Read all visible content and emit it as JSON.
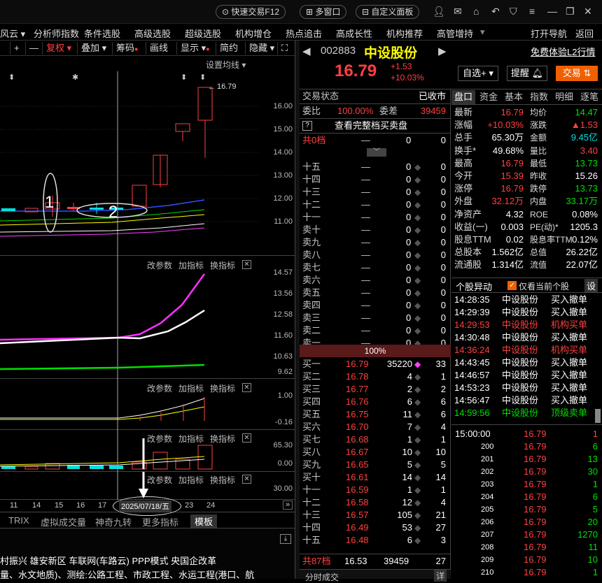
{
  "topbar": {
    "quick_trade": "快速交易F12",
    "multi_window": "多窗口",
    "custom_panel": "自定义面板"
  },
  "menu": {
    "items": [
      "风云",
      "分析师指数",
      "条件选股",
      "高级选股",
      "超级选股",
      "机构增仓",
      "热点追击",
      "高成长性",
      "机构推荐",
      "高管增持"
    ],
    "open_nav": "打开导航",
    "back": "返回"
  },
  "chart_toolbar": {
    "restore": "复权",
    "overlay": "叠加",
    "chips": "筹码",
    "draw": "画线",
    "display": "显示",
    "simple": "简约",
    "hide": "隐藏",
    "set_ma": "设置均线"
  },
  "kline": {
    "axis": [
      "16.00",
      "15.00",
      "14.00",
      "13.00",
      "12.00",
      "11.00"
    ],
    "max_label": "16.79",
    "anno1": "1",
    "anno2": "2"
  },
  "panel_actions": {
    "change_param": "改参数",
    "add_index": "加指标",
    "switch_index": "换指标"
  },
  "ind1": {
    "axis": [
      "14.57",
      "13.56",
      "12.58",
      "11.60",
      "10.63",
      "9.62"
    ]
  },
  "ind2": {
    "axis": [
      "1.00",
      "-0.16"
    ]
  },
  "ind3": {
    "axis": [
      "65.30",
      "0.00"
    ]
  },
  "ind4": {
    "axis": [
      "30.00"
    ]
  },
  "xaxis": {
    "labels": [
      "11",
      "14",
      "15",
      "16",
      "17",
      "23",
      "24"
    ],
    "selected_date": "2025/07/18/五"
  },
  "tabs": {
    "items": [
      "TRIX",
      "虚拟成交量",
      "神奇九转",
      "更多指标",
      "模板"
    ]
  },
  "news": {
    "line1": "村振兴  雄安新区  车联网(车路云)  PPP模式  央国企改革",
    "line2": "量、水文地质)、测绘:公路工程、市政工程、水运工程(港口、航"
  },
  "stock": {
    "code": "002883",
    "name": "中设股份",
    "price": "16.79",
    "change": "+1.53",
    "pct": "+10.03%",
    "l2": "免费体验L2行情",
    "watchlist": "自选+",
    "alert": "提醒",
    "trade": "交易"
  },
  "ob": {
    "status_label": "交易状态",
    "status": "已收市",
    "ratio_label": "委比",
    "ratio": "100.00%",
    "diff_label": "委差",
    "diff": "39459",
    "full": "查看完整档买卖盘",
    "total0": "共0档",
    "total0_v1": "0",
    "total0_v2": "0",
    "pct": "100%",
    "upper": [
      {
        "l": "十五",
        "p": "—",
        "v": "0",
        "c": "0"
      },
      {
        "l": "十四",
        "p": "—",
        "v": "0",
        "c": "0"
      },
      {
        "l": "十三",
        "p": "—",
        "v": "0",
        "c": "0"
      },
      {
        "l": "十二",
        "p": "—",
        "v": "0",
        "c": "0"
      },
      {
        "l": "十一",
        "p": "—",
        "v": "0",
        "c": "0"
      },
      {
        "l": "卖十",
        "p": "—",
        "v": "0",
        "c": "0"
      },
      {
        "l": "卖九",
        "p": "—",
        "v": "0",
        "c": "0"
      },
      {
        "l": "卖八",
        "p": "—",
        "v": "0",
        "c": "0"
      },
      {
        "l": "卖七",
        "p": "—",
        "v": "0",
        "c": "0"
      },
      {
        "l": "卖六",
        "p": "—",
        "v": "0",
        "c": "0"
      },
      {
        "l": "卖五",
        "p": "—",
        "v": "0",
        "c": "0"
      },
      {
        "l": "卖四",
        "p": "—",
        "v": "0",
        "c": "0"
      },
      {
        "l": "卖三",
        "p": "—",
        "v": "0",
        "c": "0"
      },
      {
        "l": "卖二",
        "p": "—",
        "v": "0",
        "c": "0"
      },
      {
        "l": "卖一",
        "p": "—",
        "v": "0",
        "c": "0"
      }
    ],
    "lower": [
      {
        "l": "买一",
        "p": "16.79",
        "v": "35220",
        "c": "33"
      },
      {
        "l": "买二",
        "p": "16.78",
        "v": "4",
        "c": "1"
      },
      {
        "l": "买三",
        "p": "16.77",
        "v": "2",
        "c": "2"
      },
      {
        "l": "买四",
        "p": "16.76",
        "v": "6",
        "c": "6"
      },
      {
        "l": "买五",
        "p": "16.75",
        "v": "11",
        "c": "6"
      },
      {
        "l": "买六",
        "p": "16.70",
        "v": "7",
        "c": "4"
      },
      {
        "l": "买七",
        "p": "16.68",
        "v": "1",
        "c": "1"
      },
      {
        "l": "买八",
        "p": "16.67",
        "v": "10",
        "c": "10"
      },
      {
        "l": "买九",
        "p": "16.65",
        "v": "5",
        "c": "5"
      },
      {
        "l": "买十",
        "p": "16.61",
        "v": "14",
        "c": "14"
      },
      {
        "l": "十一",
        "p": "16.59",
        "v": "1",
        "c": "1"
      },
      {
        "l": "十二",
        "p": "16.58",
        "v": "12",
        "c": "4"
      },
      {
        "l": "十三",
        "p": "16.57",
        "v": "105",
        "c": "21"
      },
      {
        "l": "十四",
        "p": "16.49",
        "v": "53",
        "c": "27"
      },
      {
        "l": "十五",
        "p": "16.48",
        "v": "6",
        "c": "3"
      }
    ],
    "total87": "共87档",
    "total87_p": "16.53",
    "total87_v": "39459",
    "total87_c": "27",
    "tick_title": "分时成交",
    "tick_more": "详"
  },
  "dtabs": [
    "盘口",
    "资金",
    "基本",
    "指数",
    "明细",
    "逐笔"
  ],
  "quote": [
    {
      "a": "最新",
      "av": "16.79",
      "ac": "r",
      "b": "均价",
      "bv": "14.47",
      "bc": "g"
    },
    {
      "a": "涨幅",
      "av": "+10.03%",
      "ac": "r",
      "b": "涨跌",
      "bv": "▲1.53",
      "bc": "r"
    },
    {
      "a": "总手",
      "av": "65.30万",
      "ac": "w",
      "b": "金额",
      "bv": "9.45亿",
      "bc": "c"
    },
    {
      "a": "换手*",
      "av": "49.68%",
      "ac": "w",
      "b": "量比",
      "bv": "3.40",
      "bc": "r"
    },
    {
      "a": "最高",
      "av": "16.79",
      "ac": "r",
      "b": "最低",
      "bv": "13.73",
      "bc": "g"
    },
    {
      "a": "今开",
      "av": "15.39",
      "ac": "r",
      "b": "昨收",
      "bv": "15.26",
      "bc": "w"
    },
    {
      "a": "涨停",
      "av": "16.79",
      "ac": "r",
      "b": "跌停",
      "bv": "13.73",
      "bc": "g"
    },
    {
      "a": "外盘",
      "av": "32.12万",
      "ac": "r",
      "b": "内盘",
      "bv": "33.17万",
      "bc": "g"
    },
    {
      "a": "净资产",
      "av": "4.32",
      "ac": "w",
      "b": "ROE",
      "bv": "0.08%",
      "bc": "w"
    },
    {
      "a": "收益(一)",
      "av": "0.003",
      "ac": "w",
      "b": "PE(动)*",
      "bv": "1205.3",
      "bc": "w"
    },
    {
      "a": "股息TTM",
      "av": "0.02",
      "ac": "w",
      "b": "股息率TTM",
      "bv": "0.12%",
      "bc": "w"
    },
    {
      "a": "总股本",
      "av": "1.562亿",
      "ac": "w",
      "b": "总值",
      "bv": "26.22亿",
      "bc": "w"
    },
    {
      "a": "流通股",
      "av": "1.314亿",
      "ac": "w",
      "b": "流值",
      "bv": "22.07亿",
      "bc": "w"
    }
  ],
  "events": {
    "title": "个股异动",
    "only_current": "仅看当前个股",
    "settings": "设",
    "rows": [
      {
        "t": "14:28:35",
        "n": "中设股份",
        "e": "买入撤单",
        "c": "w"
      },
      {
        "t": "14:29:39",
        "n": "中设股份",
        "e": "买入撤单",
        "c": "w"
      },
      {
        "t": "14:29:53",
        "n": "中设股份",
        "e": "机构买单",
        "c": "r"
      },
      {
        "t": "14:30:48",
        "n": "中设股份",
        "e": "买入撤单",
        "c": "w"
      },
      {
        "t": "14:36:24",
        "n": "中设股份",
        "e": "机构买单",
        "c": "r"
      },
      {
        "t": "14:43:45",
        "n": "中设股份",
        "e": "买入撤单",
        "c": "w"
      },
      {
        "t": "14:46:57",
        "n": "中设股份",
        "e": "买入撤单",
        "c": "w"
      },
      {
        "t": "14:53:23",
        "n": "中设股份",
        "e": "买入撤单",
        "c": "w"
      },
      {
        "t": "14:56:47",
        "n": "中设股份",
        "e": "买入撤单",
        "c": "w"
      },
      {
        "t": "14:59:56",
        "n": "中设股份",
        "e": "顶级卖单",
        "c": "g"
      }
    ]
  },
  "ticks": {
    "header_time": "15:00:00",
    "header_price": "16.79",
    "header_vol": "1",
    "rows": [
      {
        "i": "200",
        "p": "16.79",
        "v": "6"
      },
      {
        "i": "201",
        "p": "16.79",
        "v": "13"
      },
      {
        "i": "202",
        "p": "16.79",
        "v": "30"
      },
      {
        "i": "203",
        "p": "16.79",
        "v": "1"
      },
      {
        "i": "204",
        "p": "16.79",
        "v": "6"
      },
      {
        "i": "205",
        "p": "16.79",
        "v": "5"
      },
      {
        "i": "206",
        "p": "16.79",
        "v": "20"
      },
      {
        "i": "207",
        "p": "16.79",
        "v": "1270"
      },
      {
        "i": "208",
        "p": "16.79",
        "v": "11"
      },
      {
        "i": "209",
        "p": "16.79",
        "v": "10"
      },
      {
        "i": "210",
        "p": "16.79",
        "v": "1"
      }
    ]
  }
}
